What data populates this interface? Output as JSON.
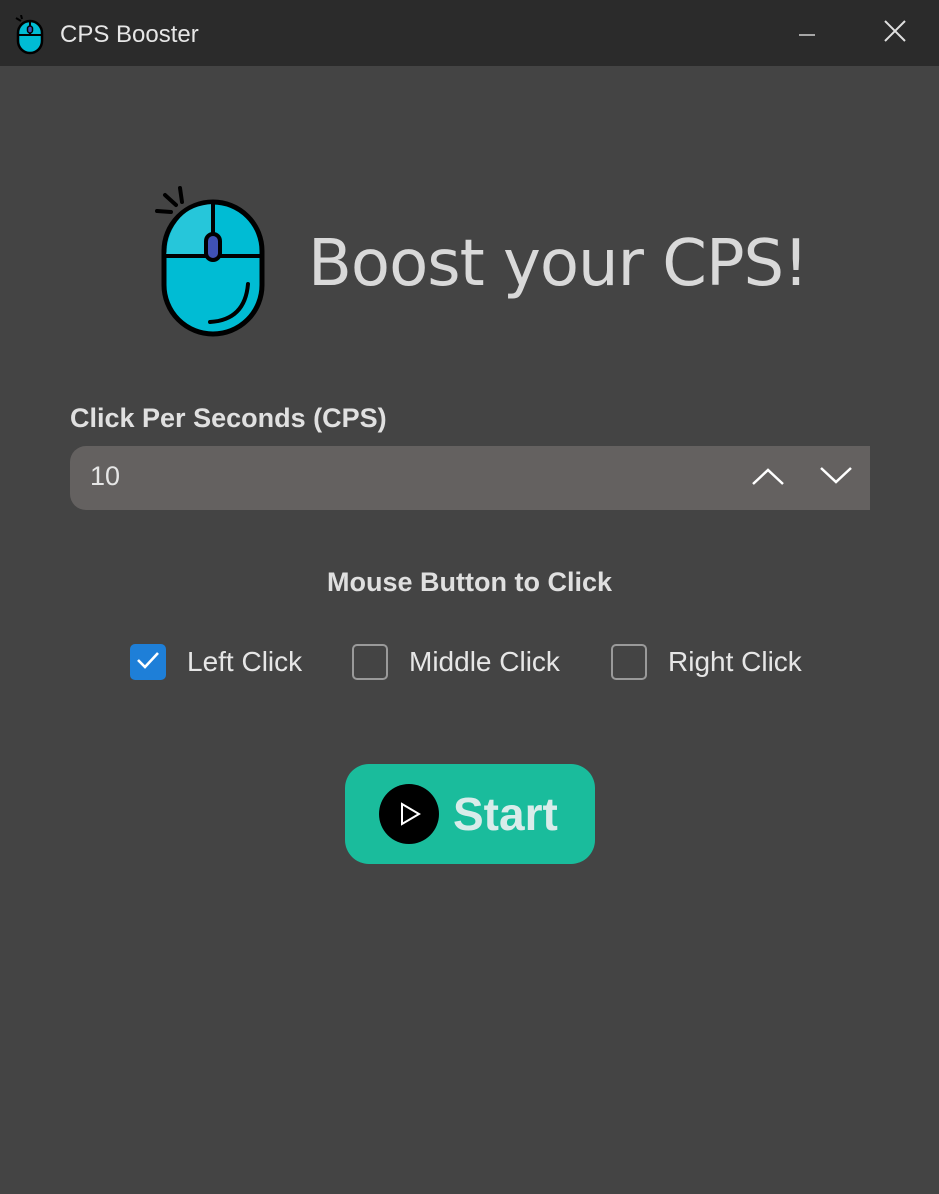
{
  "window": {
    "title": "CPS Booster",
    "app_icon": "mouse-icon",
    "controls": [
      "minimize-icon",
      "close-icon"
    ]
  },
  "hero": {
    "icon": "mouse-click-icon",
    "title": "Boost your CPS!"
  },
  "cps": {
    "label": "Click Per Seconds (CPS)",
    "value": "10",
    "up_icon": "chevron-up-icon",
    "down_icon": "chevron-down-icon"
  },
  "mouse_button": {
    "label": "Mouse Button to Click",
    "options": [
      {
        "label": "Left Click",
        "checked": true
      },
      {
        "label": "Middle Click",
        "checked": false
      },
      {
        "label": "Right Click",
        "checked": false
      }
    ]
  },
  "start": {
    "label": "Start",
    "icon": "play-icon"
  },
  "colors": {
    "background": "#444444",
    "titlebar": "#2b2b2b",
    "input_bg": "#646160",
    "accent_check": "#1e7fd8",
    "start_button": "#1abc9c",
    "mouse_cyan": "#00bcd4"
  }
}
